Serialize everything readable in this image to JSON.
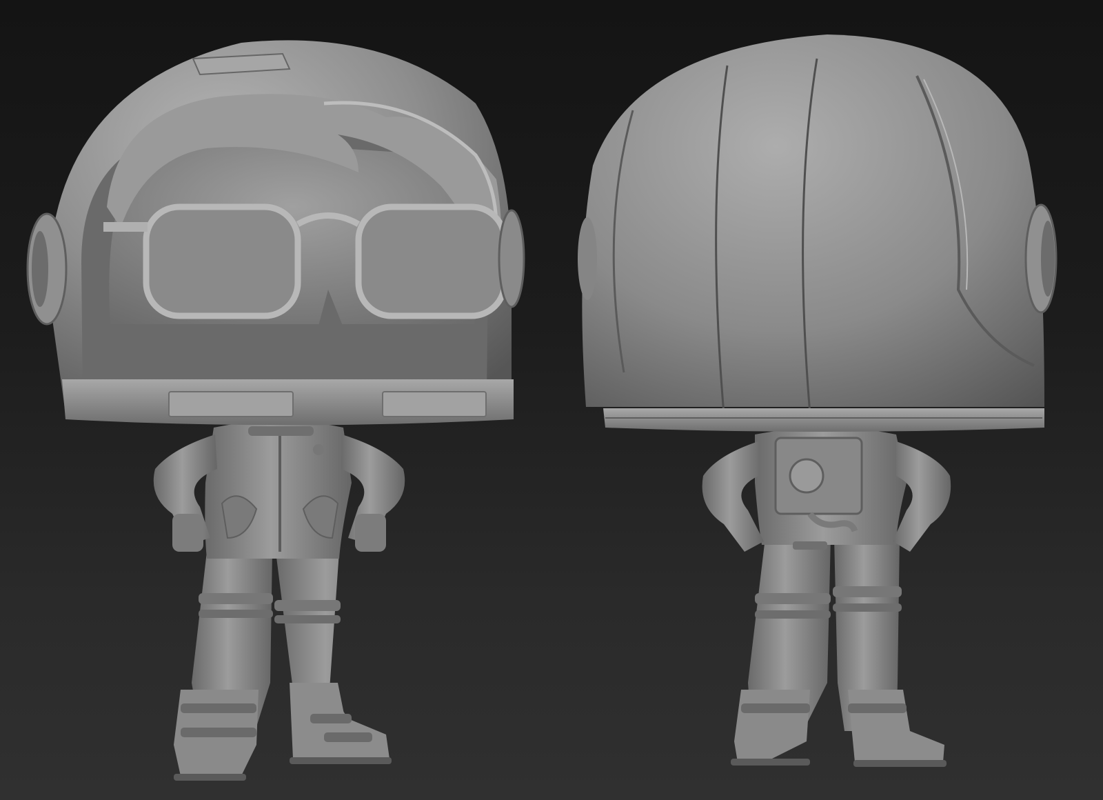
{
  "scene": {
    "background_top": "#141414",
    "background_bottom": "#303030",
    "clay_color": "#8e8e8e",
    "views": [
      {
        "id": "front",
        "subject": "astronaut-figure-front-view"
      },
      {
        "id": "back",
        "subject": "astronaut-figure-back-view"
      }
    ]
  }
}
